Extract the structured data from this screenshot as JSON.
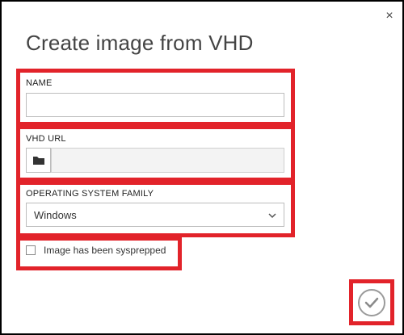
{
  "dialog": {
    "title": "Create image from VHD",
    "close_symbol": "×"
  },
  "fields": {
    "name": {
      "label": "NAME",
      "value": ""
    },
    "vhd_url": {
      "label": "VHD URL",
      "value": "",
      "browse_icon": "folder-icon"
    },
    "os_family": {
      "label": "OPERATING SYSTEM FAMILY",
      "selected": "Windows"
    },
    "sysprepped": {
      "label": "Image has been sysprepped",
      "checked": false
    }
  },
  "actions": {
    "ok_icon": "checkmark-icon"
  },
  "colors": {
    "highlight": "#e2232a",
    "text": "#444444"
  }
}
